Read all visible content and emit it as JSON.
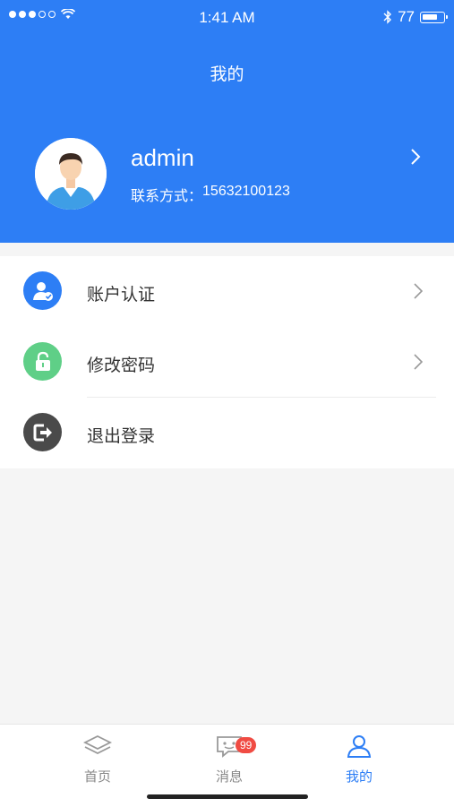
{
  "status_bar": {
    "time": "1:41 AM",
    "battery": "77",
    "battery_fraction": 0.77
  },
  "header": {
    "title": "我的",
    "username": "admin",
    "contact_label": "联系方式：",
    "contact_value": "15632100123"
  },
  "menu": {
    "items": [
      {
        "label": "账户认证",
        "icon": "user-verified-icon",
        "color": "#2d7ef5"
      },
      {
        "label": "修改密码",
        "icon": "unlock-icon",
        "color": "#5fcf87"
      },
      {
        "label": "退出登录",
        "icon": "logout-icon",
        "color": "#4a4a4a"
      }
    ]
  },
  "tabbar": {
    "tabs": [
      {
        "label": "首页",
        "icon": "layers-icon"
      },
      {
        "label": "消息",
        "icon": "message-icon",
        "badge": "99"
      },
      {
        "label": "我的",
        "icon": "person-icon"
      }
    ],
    "active_color": "#2d7ef5"
  },
  "colors": {
    "primary": "#2d7ef5",
    "background": "#f5f5f5",
    "badge": "#f04b43"
  }
}
